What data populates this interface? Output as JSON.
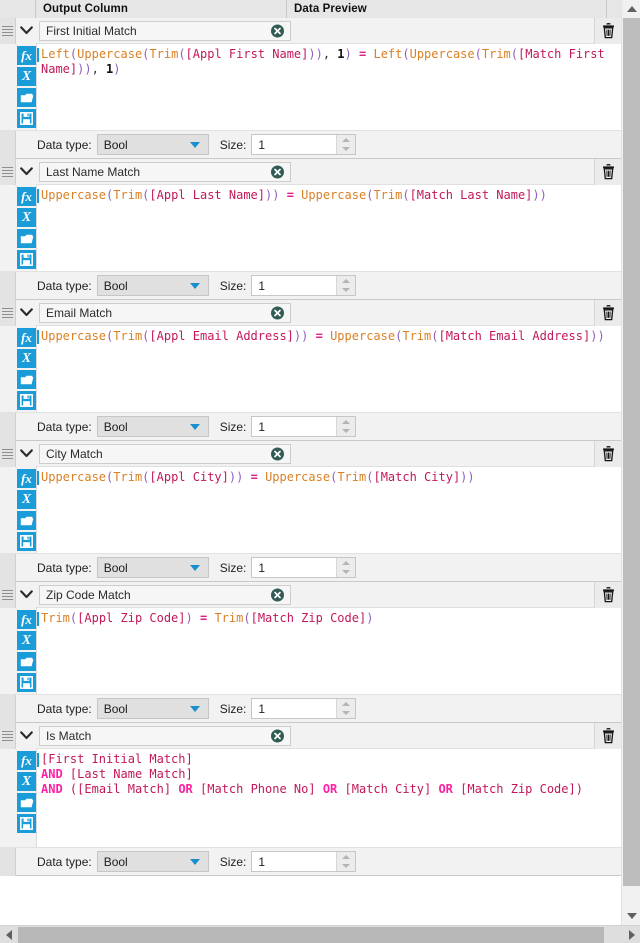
{
  "header": {
    "output_column": "Output Column",
    "data_preview": "Data Preview"
  },
  "scrollbars": {
    "vertical_up_icon": "triangle-up-icon",
    "vertical_down_icon": "triangle-down-icon",
    "horizontal_left_icon": "triangle-left-icon",
    "horizontal_right_icon": "triangle-right-icon"
  },
  "toolbar_icons": {
    "function": "fx-function-icon",
    "variable": "x-variable-icon",
    "open": "folder-open-icon",
    "save": "floppy-save-icon",
    "collapse": "chevron-down-icon",
    "drag": "drag-handle-icon",
    "clear": "clear-circle-x-icon",
    "delete": "trash-icon"
  },
  "labels": {
    "data_type": "Data type:",
    "size": "Size:"
  },
  "rows": [
    {
      "name": "First Initial Match",
      "data_type": "Bool",
      "size": "1",
      "expression_text": "Left(Uppercase(Trim([Appl First Name])), 1) = Left(Uppercase(Trim([Match First Name])), 1)",
      "tokens": [
        {
          "t": "Left",
          "c": "fn"
        },
        {
          "t": "(",
          "c": "paren"
        },
        {
          "t": "Uppercase",
          "c": "fn"
        },
        {
          "t": "(",
          "c": "paren"
        },
        {
          "t": "Trim",
          "c": "fn"
        },
        {
          "t": "(",
          "c": "paren"
        },
        {
          "t": "[Appl First Name]",
          "c": "field"
        },
        {
          "t": ")",
          "c": "paren"
        },
        {
          "t": ")",
          "c": "paren"
        },
        {
          "t": ", ",
          "c": "plain"
        },
        {
          "t": "1",
          "c": "num"
        },
        {
          "t": ")",
          "c": "paren"
        },
        {
          "t": " ",
          "c": "plain"
        },
        {
          "t": "=",
          "c": "op"
        },
        {
          "t": " ",
          "c": "plain"
        },
        {
          "t": "Left",
          "c": "fn"
        },
        {
          "t": "(",
          "c": "paren"
        },
        {
          "t": "Uppercase",
          "c": "fn"
        },
        {
          "t": "(",
          "c": "paren"
        },
        {
          "t": "Trim",
          "c": "fn"
        },
        {
          "t": "(",
          "c": "paren"
        },
        {
          "t": "[Match First Name]",
          "c": "field"
        },
        {
          "t": ")",
          "c": "paren"
        },
        {
          "t": ")",
          "c": "paren"
        },
        {
          "t": ", ",
          "c": "plain"
        },
        {
          "t": "1",
          "c": "num"
        },
        {
          "t": ")",
          "c": "paren"
        }
      ]
    },
    {
      "name": "Last Name Match",
      "data_type": "Bool",
      "size": "1",
      "expression_text": "Uppercase(Trim([Appl Last Name])) = Uppercase(Trim([Match Last Name]))",
      "tokens": [
        {
          "t": "Uppercase",
          "c": "fn"
        },
        {
          "t": "(",
          "c": "paren"
        },
        {
          "t": "Trim",
          "c": "fn"
        },
        {
          "t": "(",
          "c": "paren"
        },
        {
          "t": "[Appl Last Name]",
          "c": "field"
        },
        {
          "t": ")",
          "c": "paren"
        },
        {
          "t": ")",
          "c": "paren"
        },
        {
          "t": " ",
          "c": "plain"
        },
        {
          "t": "=",
          "c": "op"
        },
        {
          "t": " ",
          "c": "plain"
        },
        {
          "t": "Uppercase",
          "c": "fn"
        },
        {
          "t": "(",
          "c": "paren"
        },
        {
          "t": "Trim",
          "c": "fn"
        },
        {
          "t": "(",
          "c": "paren"
        },
        {
          "t": "[Match Last Name]",
          "c": "field"
        },
        {
          "t": ")",
          "c": "paren"
        },
        {
          "t": ")",
          "c": "paren"
        }
      ]
    },
    {
      "name": "Email Match",
      "data_type": "Bool",
      "size": "1",
      "expression_text": "Uppercase(Trim([Appl Email Address])) = Uppercase(Trim([Match Email Address]))",
      "tokens": [
        {
          "t": "Uppercase",
          "c": "fn"
        },
        {
          "t": "(",
          "c": "paren"
        },
        {
          "t": "Trim",
          "c": "fn"
        },
        {
          "t": "(",
          "c": "paren"
        },
        {
          "t": "[Appl Email Address]",
          "c": "field"
        },
        {
          "t": ")",
          "c": "paren"
        },
        {
          "t": ")",
          "c": "paren"
        },
        {
          "t": " ",
          "c": "plain"
        },
        {
          "t": "=",
          "c": "op"
        },
        {
          "t": " ",
          "c": "plain"
        },
        {
          "t": "Uppercase",
          "c": "fn"
        },
        {
          "t": "(",
          "c": "paren"
        },
        {
          "t": "Trim",
          "c": "fn"
        },
        {
          "t": "(",
          "c": "paren"
        },
        {
          "t": "[Match Email Address]",
          "c": "field"
        },
        {
          "t": ")",
          "c": "paren"
        },
        {
          "t": ")",
          "c": "paren"
        }
      ]
    },
    {
      "name": "City Match",
      "data_type": "Bool",
      "size": "1",
      "expression_text": "Uppercase(Trim([Appl City])) = Uppercase(Trim([Match City]))",
      "tokens": [
        {
          "t": "Uppercase",
          "c": "fn"
        },
        {
          "t": "(",
          "c": "paren"
        },
        {
          "t": "Trim",
          "c": "fn"
        },
        {
          "t": "(",
          "c": "paren"
        },
        {
          "t": "[Appl City]",
          "c": "field"
        },
        {
          "t": ")",
          "c": "paren"
        },
        {
          "t": ")",
          "c": "paren"
        },
        {
          "t": " ",
          "c": "plain"
        },
        {
          "t": "=",
          "c": "op"
        },
        {
          "t": " ",
          "c": "plain"
        },
        {
          "t": "Uppercase",
          "c": "fn"
        },
        {
          "t": "(",
          "c": "paren"
        },
        {
          "t": "Trim",
          "c": "fn"
        },
        {
          "t": "(",
          "c": "paren"
        },
        {
          "t": "[Match City]",
          "c": "field"
        },
        {
          "t": ")",
          "c": "paren"
        },
        {
          "t": ")",
          "c": "paren"
        }
      ]
    },
    {
      "name": "Zip Code Match",
      "data_type": "Bool",
      "size": "1",
      "expression_text": "Trim([Appl Zip Code]) = Trim([Match Zip Code])",
      "tokens": [
        {
          "t": "Trim",
          "c": "fn"
        },
        {
          "t": "(",
          "c": "paren"
        },
        {
          "t": "[Appl Zip Code]",
          "c": "field"
        },
        {
          "t": ")",
          "c": "paren"
        },
        {
          "t": " ",
          "c": "plain"
        },
        {
          "t": "=",
          "c": "op"
        },
        {
          "t": " ",
          "c": "plain"
        },
        {
          "t": "Trim",
          "c": "fn"
        },
        {
          "t": "(",
          "c": "paren"
        },
        {
          "t": "[Match Zip Code]",
          "c": "field"
        },
        {
          "t": ")",
          "c": "paren"
        }
      ]
    },
    {
      "name": "Is Match",
      "data_type": "Bool",
      "size": "1",
      "expression_text": "[First Initial Match]\nAND [Last Name Match]\nAND ([Email Match] OR [Match Phone No] OR [Match City] OR [Match Zip Code])",
      "tokens": [
        {
          "t": "[First Initial Match]",
          "c": "field"
        },
        {
          "t": "\n",
          "c": "plain"
        },
        {
          "t": "AND",
          "c": "logic"
        },
        {
          "t": " ",
          "c": "plain"
        },
        {
          "t": "[Last Name Match]",
          "c": "field"
        },
        {
          "t": "\n",
          "c": "plain"
        },
        {
          "t": "AND",
          "c": "logic"
        },
        {
          "t": " ",
          "c": "plain"
        },
        {
          "t": "(",
          "c": "field"
        },
        {
          "t": "[Email Match]",
          "c": "field"
        },
        {
          "t": " ",
          "c": "plain"
        },
        {
          "t": "OR",
          "c": "logic"
        },
        {
          "t": " ",
          "c": "plain"
        },
        {
          "t": "[Match Phone No]",
          "c": "field"
        },
        {
          "t": " ",
          "c": "plain"
        },
        {
          "t": "OR",
          "c": "logic"
        },
        {
          "t": " ",
          "c": "plain"
        },
        {
          "t": "[Match City]",
          "c": "field"
        },
        {
          "t": " ",
          "c": "plain"
        },
        {
          "t": "OR",
          "c": "logic"
        },
        {
          "t": " ",
          "c": "plain"
        },
        {
          "t": "[Match Zip Code]",
          "c": "field"
        },
        {
          "t": ")",
          "c": "field"
        }
      ]
    }
  ]
}
